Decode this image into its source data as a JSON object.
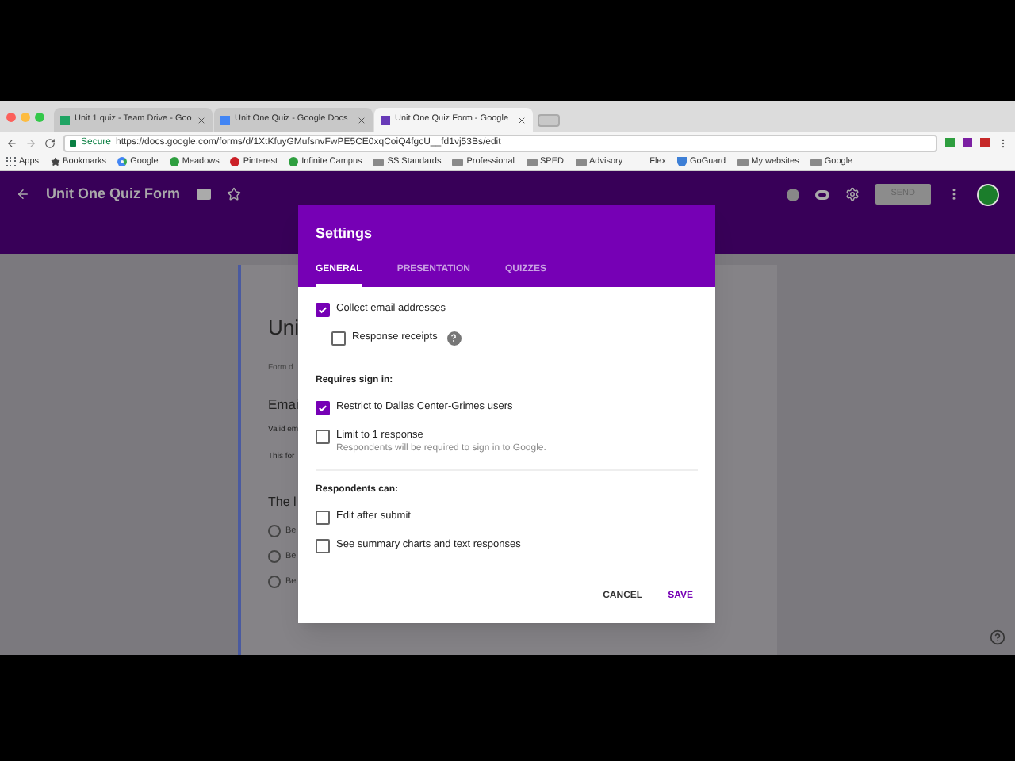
{
  "browser": {
    "tabs": [
      {
        "title": "Unit 1 quiz - Team Drive - Goo",
        "selected": false,
        "color": "#1fa463"
      },
      {
        "title": "Unit One Quiz - Google Docs",
        "selected": false,
        "color": "#4285f4"
      },
      {
        "title": "Unit One Quiz Form - Google",
        "selected": true,
        "color": "#673ab7"
      }
    ],
    "address": {
      "secure_label": "Secure",
      "url": "https://docs.google.com/forms/d/1XtKfuyGMufsnvFwPE5CE0xqCoiQ4fgcU__fd1vj53Bs/edit"
    },
    "bookmarks": [
      {
        "label": "Apps",
        "kind": "apps"
      },
      {
        "label": "Bookmarks",
        "kind": "star"
      },
      {
        "label": "Google",
        "kind": "g"
      },
      {
        "label": "Meadows",
        "kind": "site"
      },
      {
        "label": "Pinterest",
        "kind": "pin"
      },
      {
        "label": "Infinite Campus",
        "kind": "site"
      },
      {
        "label": "SS Standards",
        "kind": "folder"
      },
      {
        "label": "Professional",
        "kind": "folder"
      },
      {
        "label": "SPED",
        "kind": "folder"
      },
      {
        "label": "Advisory",
        "kind": "folder"
      },
      {
        "label": "Flex",
        "kind": "none"
      },
      {
        "label": "GoGuard",
        "kind": "shield"
      },
      {
        "label": "My websites",
        "kind": "folder"
      },
      {
        "label": "Google",
        "kind": "folder"
      }
    ]
  },
  "app_header": {
    "title": "Unit One Quiz Form",
    "send": "SEND"
  },
  "form": {
    "title": "Uni",
    "description": "Form d",
    "question": {
      "title": "Emai",
      "hint": "Valid em",
      "note": "This for"
    },
    "question2": {
      "title": "The l",
      "options": [
        {
          "label": "Be",
          "selected": false
        },
        {
          "label": "Be",
          "selected": false
        },
        {
          "label": "Be",
          "selected": false
        }
      ]
    }
  },
  "dialog": {
    "title": "Settings",
    "tabs": [
      {
        "label": "GENERAL",
        "selected": true
      },
      {
        "label": "PRESENTATION",
        "selected": false
      },
      {
        "label": "QUIZZES",
        "selected": false
      }
    ],
    "sections": [
      {
        "items": [
          {
            "label": "Collect email addresses",
            "checked": true,
            "children": [
              {
                "label": "Response receipts",
                "checked": false,
                "help_icon": true
              }
            ]
          }
        ]
      },
      {
        "heading": "Requires sign in:",
        "items": [
          {
            "label": "Restrict to Dallas Center-Grimes users",
            "checked": true
          },
          {
            "label": "Limit to 1 response",
            "checked": false,
            "note": "Respondents will be required to sign in to Google."
          }
        ]
      },
      {
        "heading": "Respondents can:",
        "items": [
          {
            "label": "Edit after submit",
            "checked": false
          },
          {
            "label": "See summary charts and text responses",
            "checked": false
          }
        ]
      }
    ],
    "buttons": {
      "cancel": "CANCEL",
      "save": "SAVE"
    }
  }
}
